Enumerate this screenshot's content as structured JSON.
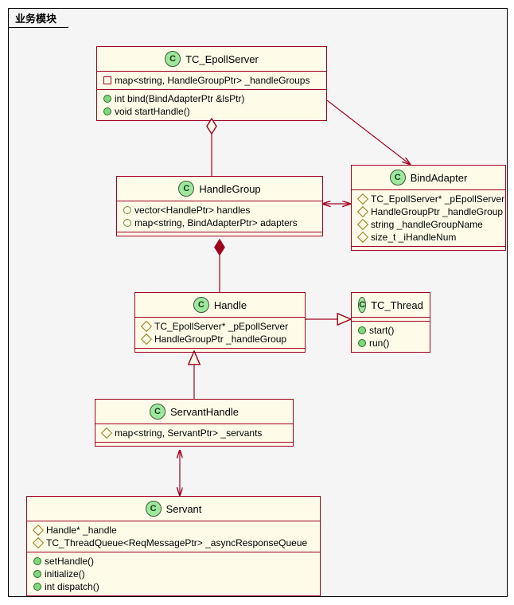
{
  "package": {
    "title": "业务模块"
  },
  "classes": {
    "epollServer": {
      "name": "TC_EpollServer",
      "attrs": [
        {
          "vis": "private-sq",
          "text": "map<string, HandleGroupPtr> _handleGroups"
        }
      ],
      "ops": [
        {
          "vis": "public-circ",
          "text": "int bind(BindAdapterPtr &lsPtr)"
        },
        {
          "vis": "public-circ",
          "text": "void startHandle()"
        }
      ]
    },
    "handleGroup": {
      "name": "HandleGroup",
      "attrs": [
        {
          "vis": "public-circ-hollow",
          "text": "vector<HandlePtr> handles"
        },
        {
          "vis": "public-circ-hollow",
          "text": "map<string, BindAdapterPtr> adapters"
        }
      ]
    },
    "bindAdapter": {
      "name": "BindAdapter",
      "attrs": [
        {
          "vis": "pkg-diamond",
          "text": "TC_EpollServer* _pEpollServer"
        },
        {
          "vis": "pkg-diamond",
          "text": "HandleGroupPtr _handleGroup"
        },
        {
          "vis": "pkg-diamond",
          "text": "string _handleGroupName"
        },
        {
          "vis": "pkg-diamond",
          "text": "size_t _iHandleNum"
        }
      ]
    },
    "handle": {
      "name": "Handle",
      "attrs": [
        {
          "vis": "pkg-diamond",
          "text": "TC_EpollServer* _pEpollServer"
        },
        {
          "vis": "pkg-diamond",
          "text": "HandleGroupPtr _handleGroup"
        }
      ]
    },
    "tcThread": {
      "name": "TC_Thread",
      "ops": [
        {
          "vis": "public-circ",
          "text": "start()"
        },
        {
          "vis": "public-circ",
          "text": "run()"
        }
      ]
    },
    "servantHandle": {
      "name": "ServantHandle",
      "attrs": [
        {
          "vis": "pkg-diamond",
          "text": "map<string, ServantPtr> _servants"
        }
      ]
    },
    "servant": {
      "name": "Servant",
      "attrs": [
        {
          "vis": "pkg-diamond",
          "text": "Handle* _handle"
        },
        {
          "vis": "pkg-diamond",
          "text": "TC_ThreadQueue<ReqMessagePtr> _asyncResponseQueue"
        }
      ],
      "ops": [
        {
          "vis": "public-circ",
          "text": "setHandle()"
        },
        {
          "vis": "public-circ",
          "text": "initialize()"
        },
        {
          "vis": "public-circ",
          "text": "int dispatch()"
        }
      ]
    }
  }
}
